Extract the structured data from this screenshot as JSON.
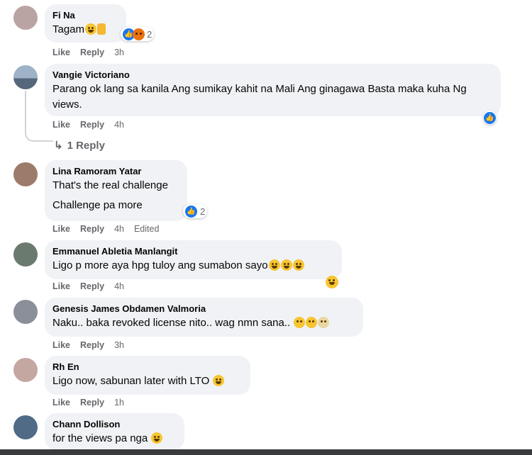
{
  "comments": [
    {
      "author": "Fi Na",
      "text": "Tagam",
      "actions": {
        "like": "Like",
        "reply": "Reply",
        "time": "3h"
      },
      "reaction_count": "2",
      "avatar_color": "#b9a4a3"
    },
    {
      "author": "Vangie Victoriano",
      "text": "Parang ok lang sa kanila Ang sumikay kahit na Mali Ang ginagawa Basta maka kuha Ng views.",
      "actions": {
        "like": "Like",
        "reply": "Reply",
        "time": "4h"
      },
      "view_replies": "1 Reply",
      "avatar_color": "#7d8fa6"
    },
    {
      "author": "Lina Ramoram Yatar",
      "text": "That's the real challenge",
      "text2": "Challenge pa more",
      "actions": {
        "like": "Like",
        "reply": "Reply",
        "time": "4h",
        "edited": "Edited"
      },
      "reaction_count": "2",
      "avatar_color": "#9c7b6a"
    },
    {
      "author": "Emmanuel Abletia Manlangit",
      "text": "Ligo p more aya hpg tuloy ang sumabon sayo",
      "actions": {
        "like": "Like",
        "reply": "Reply",
        "time": "4h"
      },
      "avatar_color": "#6b7a6f"
    },
    {
      "author": "Genesis James Obdamen Valmoria",
      "text": "Naku.. baka revoked license nito.. wag nmn sana..",
      "actions": {
        "like": "Like",
        "reply": "Reply",
        "time": "3h"
      },
      "avatar_color": "#8a8f99"
    },
    {
      "author": "Rh En",
      "text": "Ligo now, sabunan later with LTO",
      "actions": {
        "like": "Like",
        "reply": "Reply",
        "time": "1h"
      },
      "avatar_color": "#c3a7a0"
    },
    {
      "author": "Chann Dollison",
      "text": "for the views pa nga",
      "avatar_color": "#4f6b86"
    }
  ],
  "colors": {
    "accent": "#1877f2",
    "bubble": "#f0f2f5",
    "meta": "#65676b"
  }
}
